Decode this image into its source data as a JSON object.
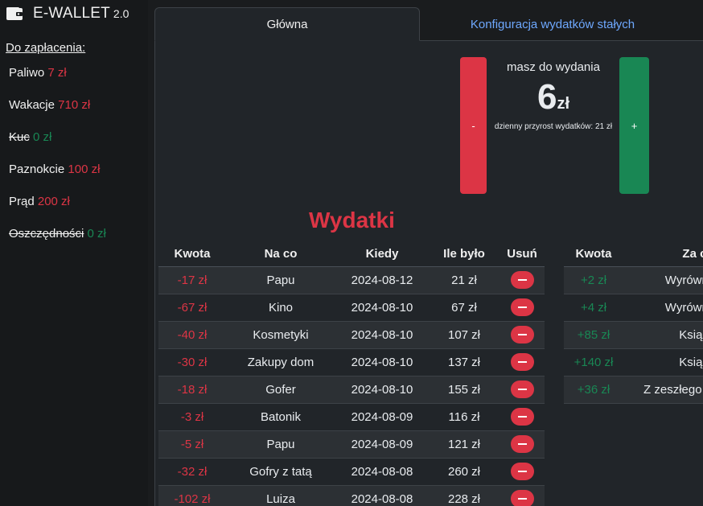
{
  "brand": {
    "title": "E-WALLET",
    "version": "2.0",
    "icon": "wallet-icon"
  },
  "sidebar": {
    "header": "Do zapłacenia:",
    "items": [
      {
        "name": "Paliwo",
        "amount": "7 zł",
        "done": false
      },
      {
        "name": "Wakacje",
        "amount": "710 zł",
        "done": false
      },
      {
        "name": "Kuc",
        "amount": "0 zł",
        "done": true
      },
      {
        "name": "Paznokcie",
        "amount": "100 zł",
        "done": false
      },
      {
        "name": "Prąd",
        "amount": "200 zł",
        "done": false
      },
      {
        "name": "Oszczędności",
        "amount": "0 zł",
        "done": true
      }
    ]
  },
  "tabs": {
    "main": "Główna",
    "config": "Konfiguracja wydatków stałych"
  },
  "balance": {
    "label": "masz do wydania",
    "value": "6",
    "currency": "zł",
    "daily": "dzienny przyrost wydatków: 21 zł",
    "minus_label": "-",
    "plus_label": "+"
  },
  "expenses": {
    "title": "Wydatki",
    "headers": [
      "Kwota",
      "Na co",
      "Kiedy",
      "Ile było",
      "Usuń"
    ],
    "rows": [
      {
        "amount": "-17 zł",
        "what": "Papu",
        "when": "2024-08-12",
        "before": "21 zł"
      },
      {
        "amount": "-67 zł",
        "what": "Kino",
        "when": "2024-08-10",
        "before": "67 zł"
      },
      {
        "amount": "-40 zł",
        "what": "Kosmetyki",
        "when": "2024-08-10",
        "before": "107 zł"
      },
      {
        "amount": "-30 zł",
        "what": "Zakupy dom",
        "when": "2024-08-10",
        "before": "137 zł"
      },
      {
        "amount": "-18 zł",
        "what": "Gofer",
        "when": "2024-08-10",
        "before": "155 zł"
      },
      {
        "amount": "-3 zł",
        "what": "Batonik",
        "when": "2024-08-09",
        "before": "116 zł"
      },
      {
        "amount": "-5 zł",
        "what": "Papu",
        "when": "2024-08-09",
        "before": "121 zł"
      },
      {
        "amount": "-32 zł",
        "what": "Gofry z tatą",
        "when": "2024-08-08",
        "before": "260 zł"
      },
      {
        "amount": "-102 zł",
        "what": "Luiza",
        "when": "2024-08-08",
        "before": "228 zł"
      }
    ]
  },
  "income": {
    "headers": [
      "Kwota",
      "Za co"
    ],
    "rows": [
      {
        "amount": "+2 zł",
        "what": "Wyrównanie"
      },
      {
        "amount": "+4 zł",
        "what": "Wyrównanie"
      },
      {
        "amount": "+85 zł",
        "what": "Książki"
      },
      {
        "amount": "+140 zł",
        "what": "Książki"
      },
      {
        "amount": "+36 zł",
        "what": "Z zeszłego miesiąca"
      }
    ]
  },
  "colors": {
    "negative": "#dc3545",
    "positive": "#198754",
    "link": "#6ea8fe"
  }
}
